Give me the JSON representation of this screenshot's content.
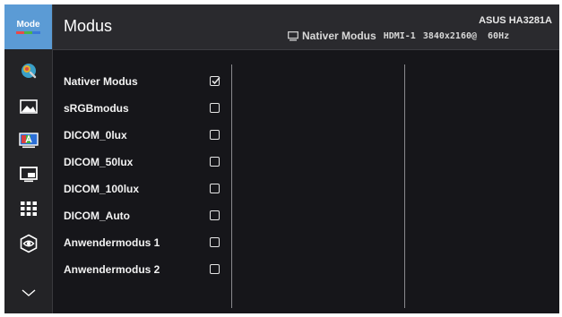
{
  "rail": {
    "mode_label": "Mode",
    "mode_bar_colors": [
      "#e84a4a",
      "#4ab54a",
      "#3a78d8"
    ],
    "icons": [
      "color-icon",
      "image-icon",
      "input-select-icon",
      "pip-pbp-icon",
      "system-setup-icon",
      "blue-light-filter-icon",
      "chevron-down-icon"
    ]
  },
  "header": {
    "title": "Modus",
    "model": "ASUS HA3281A",
    "current_mode": "Nativer Modus",
    "input": "HDMI-1",
    "resolution": "3840x2160@",
    "refresh": "60Hz"
  },
  "modes": [
    {
      "label": "Nativer Modus",
      "checked": true
    },
    {
      "label": "sRGBmodus",
      "checked": false
    },
    {
      "label": "DICOM_0lux",
      "checked": false
    },
    {
      "label": "DICOM_50lux",
      "checked": false
    },
    {
      "label": "DICOM_100lux",
      "checked": false
    },
    {
      "label": "DICOM_Auto",
      "checked": false
    },
    {
      "label": "Anwendermodus 1",
      "checked": false
    },
    {
      "label": "Anwendermodus 2",
      "checked": false
    }
  ]
}
